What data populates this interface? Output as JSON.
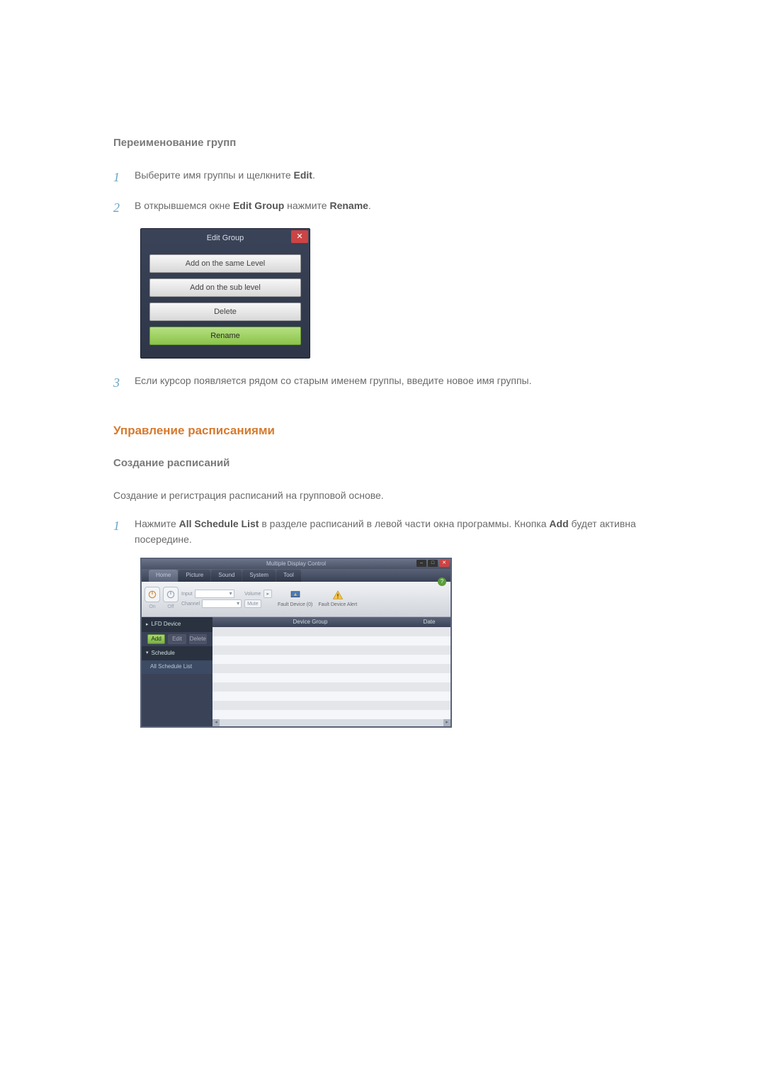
{
  "heading_rename_groups": "Переименование групп",
  "step1_text_pre": "Выберите имя группы и щелкните ",
  "step1_bold": "Edit",
  "step1_text_post": ".",
  "step2_pre": "В открывшемся окне ",
  "step2_b1": "Edit Group",
  "step2_mid": " нажмите ",
  "step2_b2": "Rename",
  "step2_post": ".",
  "step3_text": "Если курсор появляется рядом со старым именем группы, введите новое имя группы.",
  "dialog": {
    "title": "Edit Group",
    "close": "✕",
    "btn_same": "Add on the same Level",
    "btn_sub": "Add on the sub level",
    "btn_delete": "Delete",
    "btn_rename": "Rename"
  },
  "heading_schedules": "Управление расписаниями",
  "heading_create_sched": "Создание расписаний",
  "para_create": "Создание и регистрация расписаний на групповой основе.",
  "sched_step1_pre": "Нажмите ",
  "sched_step1_b1": "All Schedule List",
  "sched_step1_mid": " в разделе расписаний в левой части окна программы. Кнопка ",
  "sched_step1_b2": "Add",
  "sched_step1_post": " будет активна посередине.",
  "mdc": {
    "title": "Multiple Display Control",
    "win_min": "–",
    "win_max": "□",
    "win_close": "✕",
    "help": "?",
    "tabs": {
      "home": "Home",
      "picture": "Picture",
      "sound": "Sound",
      "system": "System",
      "tool": "Tool"
    },
    "ribbon": {
      "on_lbl": "On",
      "off_lbl": "Off",
      "input_lbl": "Input",
      "channel_lbl": "Channel",
      "volume_lbl": "Volume",
      "mute_btn": "Mute",
      "fault1": "Fault Device (0)",
      "fault2": "Fault Device Alert"
    },
    "actions": {
      "add": "Add",
      "edit": "Edit",
      "delete": "Delete"
    },
    "side": {
      "lfd": "LFD Device",
      "schedule": "Schedule",
      "all_list": "All Schedule List"
    },
    "grid": {
      "col1": "Device Group",
      "col2": "Date"
    }
  },
  "nums": {
    "n1": "1",
    "n2": "2",
    "n3": "3"
  }
}
